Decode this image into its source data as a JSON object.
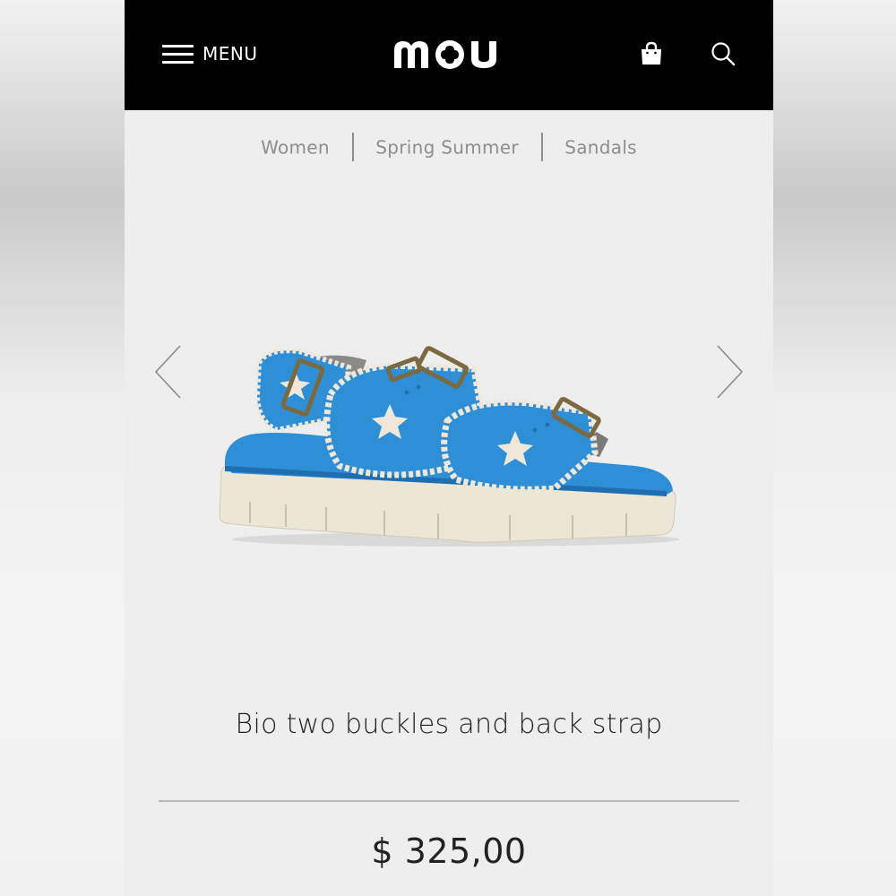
{
  "header": {
    "menu_label": "MENU",
    "brand_icon": "mou-logo"
  },
  "breadcrumb": [
    "Women",
    "Spring Summer",
    "Sandals"
  ],
  "carousel": {
    "prev_icon": "chevron-left-icon",
    "next_icon": "chevron-right-icon"
  },
  "product": {
    "title": "Bio two buckles and back strap",
    "price": "$ 325,00",
    "colors": {
      "suede": "#2f8fd6",
      "crochet": "#efe8da",
      "sole": "#ece6d6",
      "buckle": "#7a6a44"
    }
  }
}
